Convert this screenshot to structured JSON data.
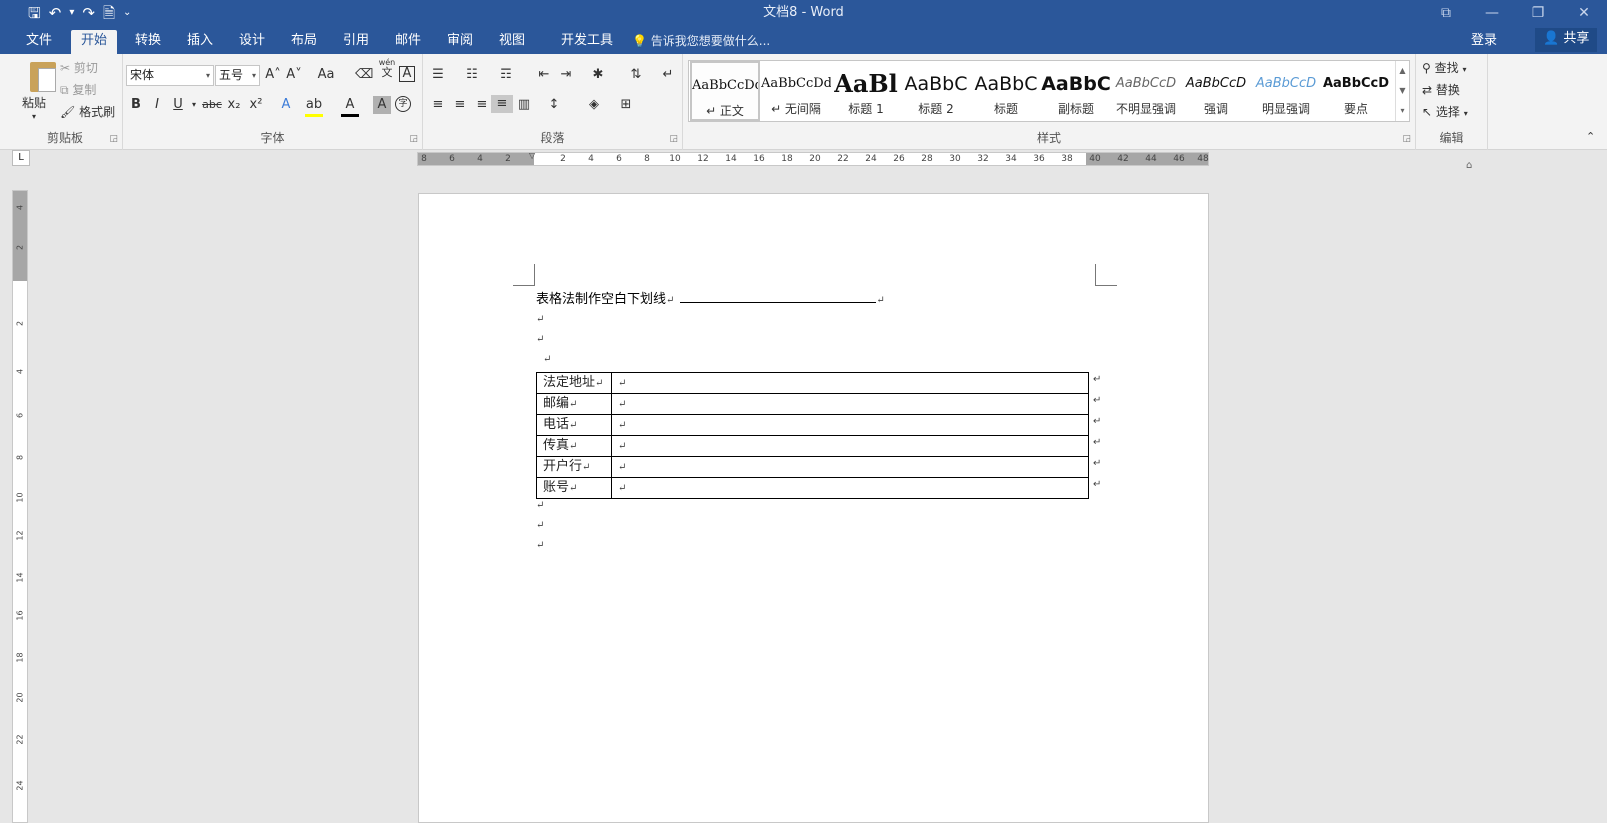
{
  "window": {
    "title": "文档8 - Word",
    "controls": [
      "⧉",
      "—",
      "❐",
      "✕"
    ]
  },
  "qat": {
    "save": "🖫",
    "undo": "↶",
    "redo": "↷",
    "touch": "🗎",
    "customize": "⌄"
  },
  "tabs": [
    "文件",
    "开始",
    "转换",
    "插入",
    "设计",
    "布局",
    "引用",
    "邮件",
    "审阅",
    "视图",
    "开发工具"
  ],
  "active_tab": "开始",
  "tell_me": "告诉我您想要做什么...",
  "login": "登录",
  "share": "共享",
  "clipboard": {
    "label": "剪贴板",
    "paste": "粘贴",
    "cut": "剪切",
    "copy": "复制",
    "format_painter": "格式刷"
  },
  "font": {
    "label": "字体",
    "family": "宋体",
    "size": "五号",
    "grow": "A˄",
    "shrink": "A˅",
    "case": "Aa",
    "phonetic_top": "wén",
    "phonetic_bot": "文",
    "bold": "B",
    "italic": "I",
    "underline": "U",
    "strike": "abc",
    "sub": "x₂",
    "sup": "x²",
    "effects": "A",
    "highlight": "ab",
    "color": "A",
    "shading": "A",
    "enclose": "字"
  },
  "paragraph": {
    "label": "段落"
  },
  "styles": {
    "label": "样式",
    "items": [
      {
        "preview": "AaBbCcDd",
        "name": "↵ 正文"
      },
      {
        "preview": "AaBbCcDd",
        "name": "↵ 无间隔"
      },
      {
        "preview": "AaBl",
        "name": "标题 1"
      },
      {
        "preview": "AaBbC",
        "name": "标题 2"
      },
      {
        "preview": "AaBbC",
        "name": "标题"
      },
      {
        "preview": "AaBbC",
        "name": "副标题"
      },
      {
        "preview": "AaBbCcD",
        "name": "不明显强调"
      },
      {
        "preview": "AaBbCcD",
        "name": "强调"
      },
      {
        "preview": "AaBbCcD",
        "name": "明显强调"
      },
      {
        "preview": "AaBbCcD",
        "name": "要点"
      }
    ]
  },
  "editing": {
    "label": "编辑",
    "find": "查找",
    "replace": "替换",
    "select": "选择"
  },
  "ruler": {
    "h_left": [
      "8",
      "6",
      "4",
      "2"
    ],
    "h_right": [
      "2",
      "4",
      "6",
      "8",
      "10",
      "12",
      "14",
      "16",
      "18",
      "20",
      "22",
      "24",
      "26",
      "28",
      "30",
      "32",
      "34",
      "36",
      "38",
      "40",
      "42",
      "44",
      "46",
      "48"
    ],
    "v": [
      "4",
      "2",
      "2",
      "4",
      "6",
      "8",
      "10",
      "12",
      "14",
      "16",
      "18",
      "20",
      "22",
      "24"
    ],
    "tab_selector": "L"
  },
  "document": {
    "heading": "表格法制作空白下划线",
    "para_mark": "↵",
    "table": [
      {
        "label": "法定地址",
        "value": ""
      },
      {
        "label": "邮编",
        "value": ""
      },
      {
        "label": "电话",
        "value": ""
      },
      {
        "label": "传真",
        "value": ""
      },
      {
        "label": "开户行",
        "value": ""
      },
      {
        "label": "账号",
        "value": ""
      }
    ]
  }
}
